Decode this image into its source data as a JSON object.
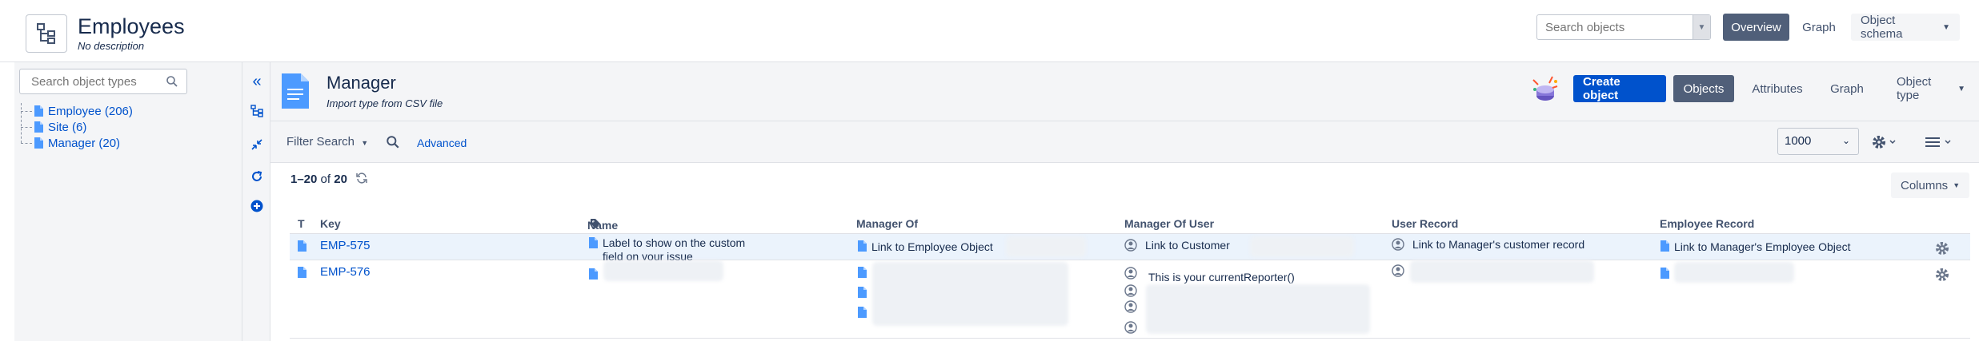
{
  "header": {
    "title": "Employees",
    "subtitle": "No description",
    "search_placeholder": "Search objects",
    "overview_label": "Overview",
    "graph_label": "Graph",
    "object_schema_label": "Object schema"
  },
  "sidebar": {
    "search_placeholder": "Search object types",
    "items": [
      {
        "label": "Employee (206)"
      },
      {
        "label": "Site (6)"
      },
      {
        "label": "Manager (20)"
      }
    ]
  },
  "object_type": {
    "title": "Manager",
    "subtitle": "Import type from CSV file",
    "create_label": "Create object",
    "tabs": [
      {
        "label": "Objects"
      },
      {
        "label": "Attributes"
      },
      {
        "label": "Graph"
      },
      {
        "label": "Object type"
      }
    ]
  },
  "filter": {
    "filter_search_label": "Filter Search",
    "advanced_label": "Advanced",
    "page_size": "1000"
  },
  "results": {
    "range": "1–20",
    "of": "of",
    "total": "20",
    "columns_label": "Columns"
  },
  "table": {
    "headers": {
      "t": "T",
      "key": "Key",
      "name": "Name",
      "manager_of": "Manager Of",
      "manager_of_user": "Manager Of User",
      "user_record": "User Record",
      "employee_record": "Employee Record"
    },
    "rows": [
      {
        "key": "EMP-575",
        "name_line1": "Label to show on the custom",
        "name_line2": "field on your issue",
        "manager_of": "Link to Employee Object",
        "manager_of_user": "Link to Customer",
        "user_record": "Link to Manager's customer record",
        "employee_record": "Link to Manager's Employee Object"
      },
      {
        "key": "EMP-576",
        "manager_of_user": "This is your currentReporter()"
      }
    ]
  },
  "colors": {
    "accent": "#0052cc",
    "dark_button": "#505f79",
    "panel_bg": "#f4f5f7",
    "row_highlight": "#ebf3fc"
  }
}
